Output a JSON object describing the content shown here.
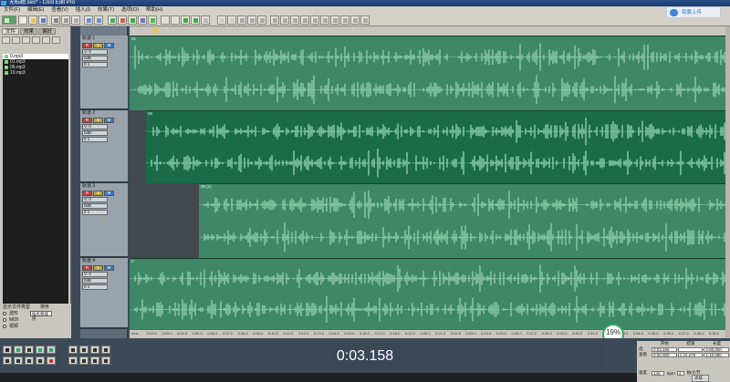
{
  "window": {
    "title": "无标题.ses* - Cool Edit Pro"
  },
  "menu": [
    "文件(F)",
    "编辑(E)",
    "查看(V)",
    "插入(I)",
    "效果(T)",
    "选项(O)",
    "帮助(H)"
  ],
  "upload_button": {
    "label": "我要上传"
  },
  "left_panel": {
    "tabs": [
      "文件",
      "效果",
      "偏好"
    ],
    "files": [
      "0.mp3",
      "01.mp3",
      "06.mp3",
      "10.mp3"
    ],
    "selected_index": 0,
    "display_type_label": "显示文件类型",
    "sort_label": "排序",
    "options": [
      "波形",
      "MIDI",
      "视频"
    ],
    "sort_value": "按名称排序"
  },
  "tracks": [
    {
      "name": "轨道 1",
      "vol": "V: 0",
      "db": "0dB",
      "mode": "0 1",
      "clip": "01",
      "clip_offset": 0,
      "highlight": false
    },
    {
      "name": "轨道 2",
      "vol": "V: 0",
      "db": "0dB",
      "mode": "0 1",
      "clip": "06",
      "clip_offset": 0.028,
      "highlight": true
    },
    {
      "name": "轨道 3",
      "vol": "V: 0",
      "db": "0dB",
      "mode": "0 1",
      "clip": "00 (2)",
      "clip_offset": 0.117,
      "highlight": false
    },
    {
      "name": "轨道 4",
      "vol": "V: 0",
      "db": "0dB",
      "mode": "0 1",
      "clip": "0",
      "clip_offset": 0,
      "highlight": false
    }
  ],
  "ruler_labels": [
    "hms",
    "0:02.0",
    "0:03.0",
    "0:04.0",
    "0:05.0",
    "0:06.0",
    "0:07.0",
    "0:08.0",
    "0:09.0",
    "0:10.0",
    "0:11.0",
    "0:12.0",
    "0:13.0",
    "0:14.0",
    "0:15.0",
    "0:16.0",
    "0:17.0",
    "0:18.0",
    "0:19.0",
    "0:20.0",
    "0:21.0",
    "0:22.0",
    "0:23.0",
    "0:24.0",
    "0:25.0",
    "0:26.0",
    "0:27.0",
    "0:28.0",
    "0:29.0",
    "0:30.0",
    "0:31.0",
    "0:32.0",
    "0:33.0",
    "0:34.0",
    "0:35.0",
    "0:36.0",
    "0:37.0",
    "0:38.0",
    "0:39.0"
  ],
  "cpu": {
    "percent": "19%",
    "sub": "0 KB/S"
  },
  "time_display": "0:03.158",
  "time_panel": {
    "headers": [
      "开始",
      "结束",
      "长度"
    ],
    "rows": [
      {
        "label": "选",
        "start": "0:03.158",
        "end": "",
        "length": "0:00.000"
      },
      {
        "label": "查看",
        "start": "0:00.000",
        "end": "1:10.679",
        "length": "1:10.680"
      }
    ]
  },
  "status": {
    "bpm": "145",
    "bpm_unit": "bpm",
    "bars_label": "拍/小节",
    "bars": "4",
    "advanced": "高级..."
  },
  "colors": {
    "wave_fill": "#5b9b7f",
    "wave_bg": "#3f8867",
    "wave_bg_selected": "#1b6b4a",
    "wave_stroke": "#a9e6c6",
    "wave_stroke_selected": "#b6f5d8"
  }
}
